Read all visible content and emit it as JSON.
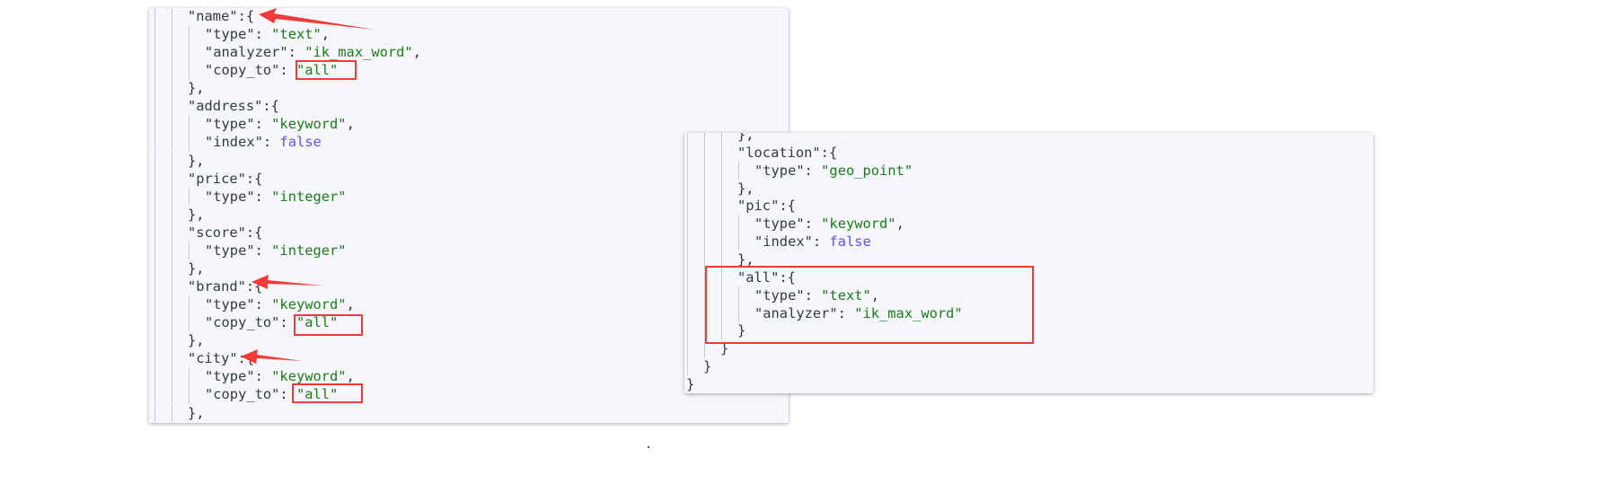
{
  "colors": {
    "panel_background": "#f5f7fa",
    "key": "#333a44",
    "string_value": "#1d7a1d",
    "boolean_value": "#5b52e6",
    "annotation_red": "#f03b3b"
  },
  "left_panel": {
    "lines": [
      {
        "d": 2,
        "t": [
          [
            "k",
            "\"name\""
          ],
          [
            "p",
            ":{"
          ]
        ]
      },
      {
        "d": 3,
        "t": [
          [
            "k",
            "\"type\""
          ],
          [
            "p",
            ": "
          ],
          [
            "s",
            "\"text\""
          ],
          [
            "p",
            ","
          ]
        ]
      },
      {
        "d": 3,
        "t": [
          [
            "k",
            "\"analyzer\""
          ],
          [
            "p",
            ": "
          ],
          [
            "s",
            "\"ik_max_word\""
          ],
          [
            "p",
            ","
          ]
        ]
      },
      {
        "d": 3,
        "t": [
          [
            "k",
            "\"copy_to\""
          ],
          [
            "p",
            ": "
          ],
          [
            "s",
            "\"all\""
          ]
        ]
      },
      {
        "d": 2,
        "t": [
          [
            "p",
            "},"
          ]
        ]
      },
      {
        "d": 2,
        "t": [
          [
            "k",
            "\"address\""
          ],
          [
            "p",
            ":{"
          ]
        ]
      },
      {
        "d": 3,
        "t": [
          [
            "k",
            "\"type\""
          ],
          [
            "p",
            ": "
          ],
          [
            "s",
            "\"keyword\""
          ],
          [
            "p",
            ","
          ]
        ]
      },
      {
        "d": 3,
        "t": [
          [
            "k",
            "\"index\""
          ],
          [
            "p",
            ": "
          ],
          [
            "b",
            "false"
          ]
        ]
      },
      {
        "d": 2,
        "t": [
          [
            "p",
            "},"
          ]
        ]
      },
      {
        "d": 2,
        "t": [
          [
            "k",
            "\"price\""
          ],
          [
            "p",
            ":{"
          ]
        ]
      },
      {
        "d": 3,
        "t": [
          [
            "k",
            "\"type\""
          ],
          [
            "p",
            ": "
          ],
          [
            "s",
            "\"integer\""
          ]
        ]
      },
      {
        "d": 2,
        "t": [
          [
            "p",
            "},"
          ]
        ]
      },
      {
        "d": 2,
        "t": [
          [
            "k",
            "\"score\""
          ],
          [
            "p",
            ":{"
          ]
        ]
      },
      {
        "d": 3,
        "t": [
          [
            "k",
            "\"type\""
          ],
          [
            "p",
            ": "
          ],
          [
            "s",
            "\"integer\""
          ]
        ]
      },
      {
        "d": 2,
        "t": [
          [
            "p",
            "},"
          ]
        ]
      },
      {
        "d": 2,
        "t": [
          [
            "k",
            "\"brand\""
          ],
          [
            "p",
            ":{"
          ]
        ]
      },
      {
        "d": 3,
        "t": [
          [
            "k",
            "\"type\""
          ],
          [
            "p",
            ": "
          ],
          [
            "s",
            "\"keyword\""
          ],
          [
            "p",
            ","
          ]
        ]
      },
      {
        "d": 3,
        "t": [
          [
            "k",
            "\"copy_to\""
          ],
          [
            "p",
            ": "
          ],
          [
            "s",
            "\"all\""
          ]
        ]
      },
      {
        "d": 2,
        "t": [
          [
            "p",
            "},"
          ]
        ]
      },
      {
        "d": 2,
        "t": [
          [
            "k",
            "\"city\""
          ],
          [
            "p",
            ":{"
          ]
        ]
      },
      {
        "d": 3,
        "t": [
          [
            "k",
            "\"type\""
          ],
          [
            "p",
            ": "
          ],
          [
            "s",
            "\"keyword\""
          ],
          [
            "p",
            ","
          ]
        ]
      },
      {
        "d": 3,
        "t": [
          [
            "k",
            "\"copy_to\""
          ],
          [
            "p",
            ": "
          ],
          [
            "s",
            "\"all\""
          ]
        ]
      },
      {
        "d": 2,
        "t": [
          [
            "p",
            "},"
          ]
        ]
      }
    ]
  },
  "right_panel": {
    "lines": [
      {
        "d": 3,
        "t": [
          [
            "p",
            "},"
          ]
        ]
      },
      {
        "d": 3,
        "t": [
          [
            "k",
            "\"location\""
          ],
          [
            "p",
            ":{"
          ]
        ]
      },
      {
        "d": 4,
        "t": [
          [
            "k",
            "\"type\""
          ],
          [
            "p",
            ": "
          ],
          [
            "s",
            "\"geo_point\""
          ]
        ]
      },
      {
        "d": 3,
        "t": [
          [
            "p",
            "},"
          ]
        ]
      },
      {
        "d": 3,
        "t": [
          [
            "k",
            "\"pic\""
          ],
          [
            "p",
            ":{"
          ]
        ]
      },
      {
        "d": 4,
        "t": [
          [
            "k",
            "\"type\""
          ],
          [
            "p",
            ": "
          ],
          [
            "s",
            "\"keyword\""
          ],
          [
            "p",
            ","
          ]
        ]
      },
      {
        "d": 4,
        "t": [
          [
            "k",
            "\"index\""
          ],
          [
            "p",
            ": "
          ],
          [
            "b",
            "false"
          ]
        ]
      },
      {
        "d": 3,
        "t": [
          [
            "p",
            "},"
          ]
        ]
      },
      {
        "d": 3,
        "t": [
          [
            "k",
            "\"all\""
          ],
          [
            "p",
            ":{"
          ]
        ]
      },
      {
        "d": 4,
        "t": [
          [
            "k",
            "\"type\""
          ],
          [
            "p",
            ": "
          ],
          [
            "s",
            "\"text\""
          ],
          [
            "p",
            ","
          ]
        ]
      },
      {
        "d": 4,
        "t": [
          [
            "k",
            "\"analyzer\""
          ],
          [
            "p",
            ": "
          ],
          [
            "s",
            "\"ik_max_word\""
          ]
        ]
      },
      {
        "d": 3,
        "t": [
          [
            "p",
            "}"
          ]
        ]
      },
      {
        "d": 2,
        "t": [
          [
            "p",
            "}"
          ]
        ]
      },
      {
        "d": 1,
        "t": [
          [
            "p",
            "}"
          ]
        ]
      },
      {
        "d": 0,
        "t": [
          [
            "p",
            "}"
          ]
        ]
      }
    ]
  }
}
